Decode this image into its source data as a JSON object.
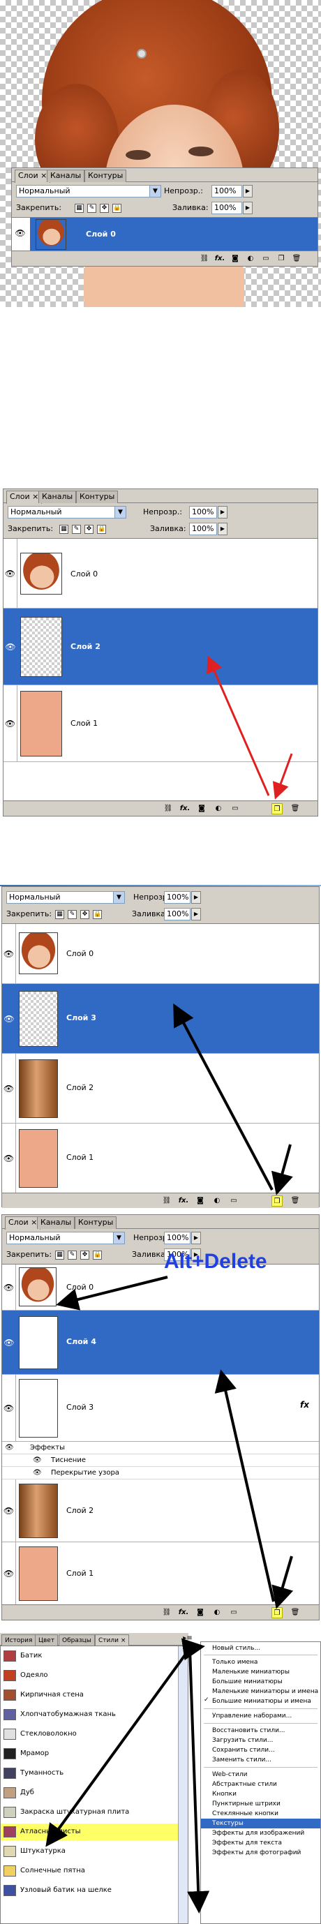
{
  "panel1": {
    "tabs": [
      "Слои ×",
      "Каналы",
      "Контуры"
    ],
    "blend": "Нормальный",
    "opacity_label": "Непрозр.:",
    "opacity": "100%",
    "lock_label": "Закрепить:",
    "fill_label": "Заливка:",
    "fill": "100%",
    "layers": [
      {
        "name": "Слой 0"
      }
    ]
  },
  "panel2": {
    "tabs": [
      "Слои ×",
      "Каналы",
      "Контуры"
    ],
    "blend": "Нормальный",
    "opacity_label": "Непрозр.:",
    "opacity": "100%",
    "lock_label": "Закрепить:",
    "fill_label": "Заливка:",
    "fill": "100%",
    "layers": [
      {
        "name": "Слой 0"
      },
      {
        "name": "Слой 2"
      },
      {
        "name": "Слой 1"
      }
    ]
  },
  "panel3": {
    "blend": "Нормальный",
    "opacity_label": "Непрозр.:",
    "opacity": "100%",
    "lock_label": "Закрепить:",
    "fill_label": "Заливка:",
    "fill": "100%",
    "layers": [
      {
        "name": "Слой 0"
      },
      {
        "name": "Слой 3"
      },
      {
        "name": "Слой 2"
      },
      {
        "name": "Слой 1"
      }
    ]
  },
  "panel4": {
    "tabs": [
      "Слои ×",
      "Каналы",
      "Контуры"
    ],
    "blend": "Нормальный",
    "opacity_label": "Непрозр.:",
    "opacity": "100%",
    "lock_label": "Закрепить:",
    "fill_label": "Заливка:",
    "fill": "100%",
    "annotation": "Alt+Delete",
    "layers": [
      {
        "name": "Слой 0"
      },
      {
        "name": "Слой 4"
      },
      {
        "name": "Слой 3"
      },
      {
        "name": "Слой 2"
      },
      {
        "name": "Слой 1"
      }
    ],
    "effects_label": "Эффекты",
    "effects": [
      "Тиснение",
      "Перекрытие узора"
    ],
    "fx": "fx"
  },
  "styles_panel": {
    "tabs": [
      "История",
      "Цвет",
      "Образцы",
      "Стили ×"
    ],
    "items": [
      "Батик",
      "Одеяло",
      "Кирпичная стена",
      "Хлопчатобумажная ткань",
      "Стекловолокно",
      "Мрамор",
      "Туманность",
      "Дуб",
      "Закраска штукатурная плита",
      "Атласные листы",
      "Штукатурка",
      "Солнечные пятна",
      "Узловый батик на шелке"
    ],
    "menu": [
      "Новый стиль...",
      "Только имена",
      "Маленькие миниатюры",
      "Большие миниатюры",
      "Маленькие миниатюры и имена",
      "Большие миниатюры и имена",
      "Управление наборами...",
      "Восстановить стили...",
      "Загрузить стили...",
      "Сохранить стили...",
      "Заменить стили...",
      "Web-стили",
      "Абстрактные стили",
      "Кнопки",
      "Пунктирные штрихи",
      "Стеклянные кнопки",
      "Текстуры",
      "Эффекты для изображений",
      "Эффекты для текста",
      "Эффекты для фотографий"
    ],
    "menu_highlight": "Текстуры",
    "menu_checked": "Большие миниатюры и имена"
  },
  "colors": {
    "selection": "#316ac5",
    "panel": "#d4d0c8",
    "arrow_red": "#e02020",
    "arrow_black": "#000000",
    "annotation_blue": "#2040e0",
    "highlight": "#ffff66"
  },
  "icons": [
    "eye-icon",
    "fx-icon",
    "mask-icon",
    "adjustment-icon",
    "folder-icon",
    "new-layer-icon",
    "trash-icon",
    "link-icon"
  ]
}
